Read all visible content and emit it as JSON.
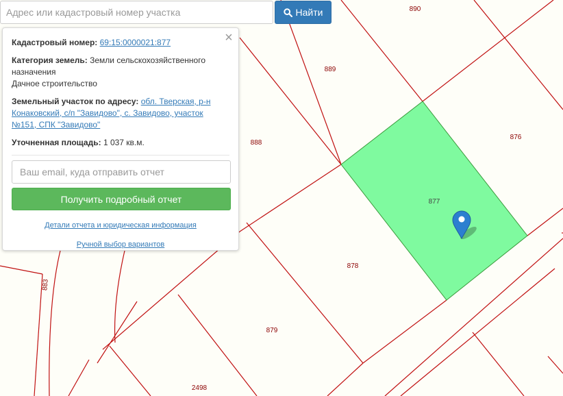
{
  "search": {
    "placeholder": "Адрес или кадастровый номер участка",
    "button_label": "Найти",
    "button_icon": "search-icon"
  },
  "popup": {
    "close_icon": "close-icon",
    "cadastral_label": "Кадастровый номер:",
    "cadastral_value": "69:15:0000021:877",
    "category_label": "Категория земель:",
    "category_value": "Земли сельскохозяйственного назначения",
    "usage": "Дачное строительство",
    "address_label": "Земельный участок по адресу:",
    "address_value": "обл. Тверская, р-н Конаковский, с/п \"Завидово\", с. Завидово, участок №151, СПК \"Завидово\"",
    "area_label": "Уточненная площадь:",
    "area_value": "1 037 кв.м.",
    "email_placeholder": "Ваш email, куда отправить отчет",
    "report_button": "Получить подробный отчет",
    "details_link": "Детали отчета и юридическая информация",
    "manual_link": "Ручной выбор вариантов"
  },
  "map": {
    "selected_parcel": "877",
    "parcel_labels": [
      "890",
      "889",
      "888",
      "876",
      "877",
      "878",
      "879",
      "2498",
      "883"
    ],
    "colors": {
      "background": "#fefef8",
      "boundary": "#c01010",
      "selected_fill": "#7ffa9f",
      "selected_stroke": "#3c9a3c",
      "label": "#8b0000",
      "marker": "#2c7fd0"
    },
    "marker_icon": "map-marker-icon"
  }
}
